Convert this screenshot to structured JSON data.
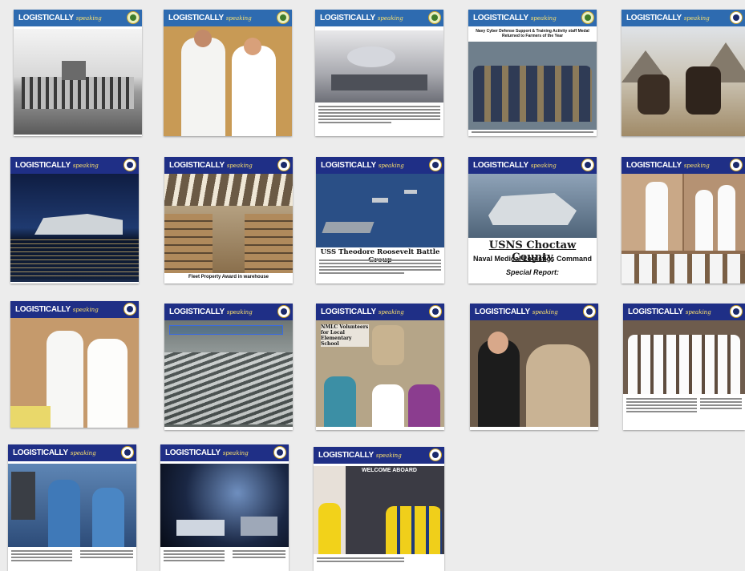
{
  "colors": {
    "blue_masthead": "#2e6bb0",
    "navy_masthead": "#1f2f86",
    "background": "#ececec"
  },
  "masthead": {
    "word": "LOGISTICALLY",
    "script": "speaking"
  },
  "covers": [
    {
      "id": "c1",
      "style": "blue",
      "seal": "green-seal-icon"
    },
    {
      "id": "c2",
      "style": "blue",
      "seal": "green-seal-icon"
    },
    {
      "id": "c3",
      "style": "blue",
      "seal": "green-seal-icon"
    },
    {
      "id": "c4",
      "style": "blue",
      "seal": "green-seal-icon",
      "subhead": "Navy Cyber Defense Support & Training Activity staff Medal Returned to Farmers of the Year"
    },
    {
      "id": "c5",
      "style": "blue",
      "seal": "navy-seal-icon"
    },
    {
      "id": "c6",
      "style": "navy",
      "seal": "navy-seal-icon"
    },
    {
      "id": "c7",
      "style": "navy",
      "seal": "navy-seal-icon",
      "caption": "Fleet Property Award in warehouse"
    },
    {
      "id": "c8",
      "style": "navy",
      "seal": "navy-seal-icon",
      "headline": "USS Theodore Roosevelt Battle Group"
    },
    {
      "id": "c9",
      "style": "navy",
      "seal": "navy-seal-icon",
      "headline": "USNS Choctaw County",
      "line2": "Naval Medical Logistics Command",
      "line3": "Special Report:"
    },
    {
      "id": "c10",
      "style": "navy",
      "seal": "navy-seal-icon"
    },
    {
      "id": "c11",
      "style": "navy",
      "seal": "navy-seal-icon"
    },
    {
      "id": "c12",
      "style": "navy",
      "seal": "navy-seal-icon"
    },
    {
      "id": "c13",
      "style": "navy",
      "seal": "navy-seal-icon",
      "overlay": "NMLC Volunteers for Local Elementary School"
    },
    {
      "id": "c14",
      "style": "navy",
      "seal": "navy-seal-icon"
    },
    {
      "id": "c15",
      "style": "navy",
      "seal": "navy-seal-icon"
    },
    {
      "id": "c16",
      "style": "navy",
      "seal": "navy-seal-icon"
    },
    {
      "id": "c17",
      "style": "navy",
      "seal": "navy-seal-icon"
    },
    {
      "id": "c18",
      "style": "navy",
      "seal": "navy-seal-icon",
      "banner": "WELCOME ABOARD"
    }
  ]
}
